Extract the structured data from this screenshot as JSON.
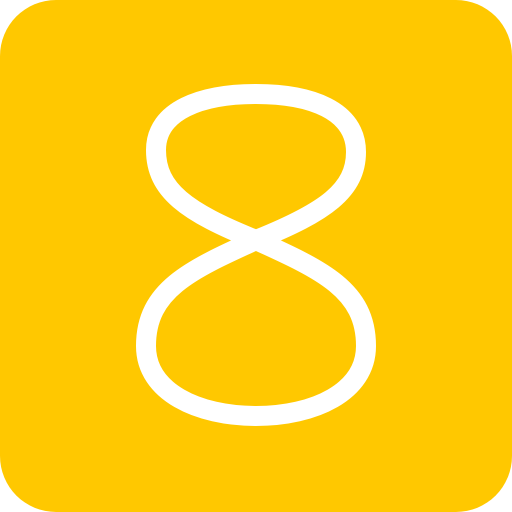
{
  "icon": {
    "digit": "8",
    "background_color": "#FFC800",
    "foreground_color": "#FFFFFF",
    "icon_name": "number-eight-icon"
  }
}
